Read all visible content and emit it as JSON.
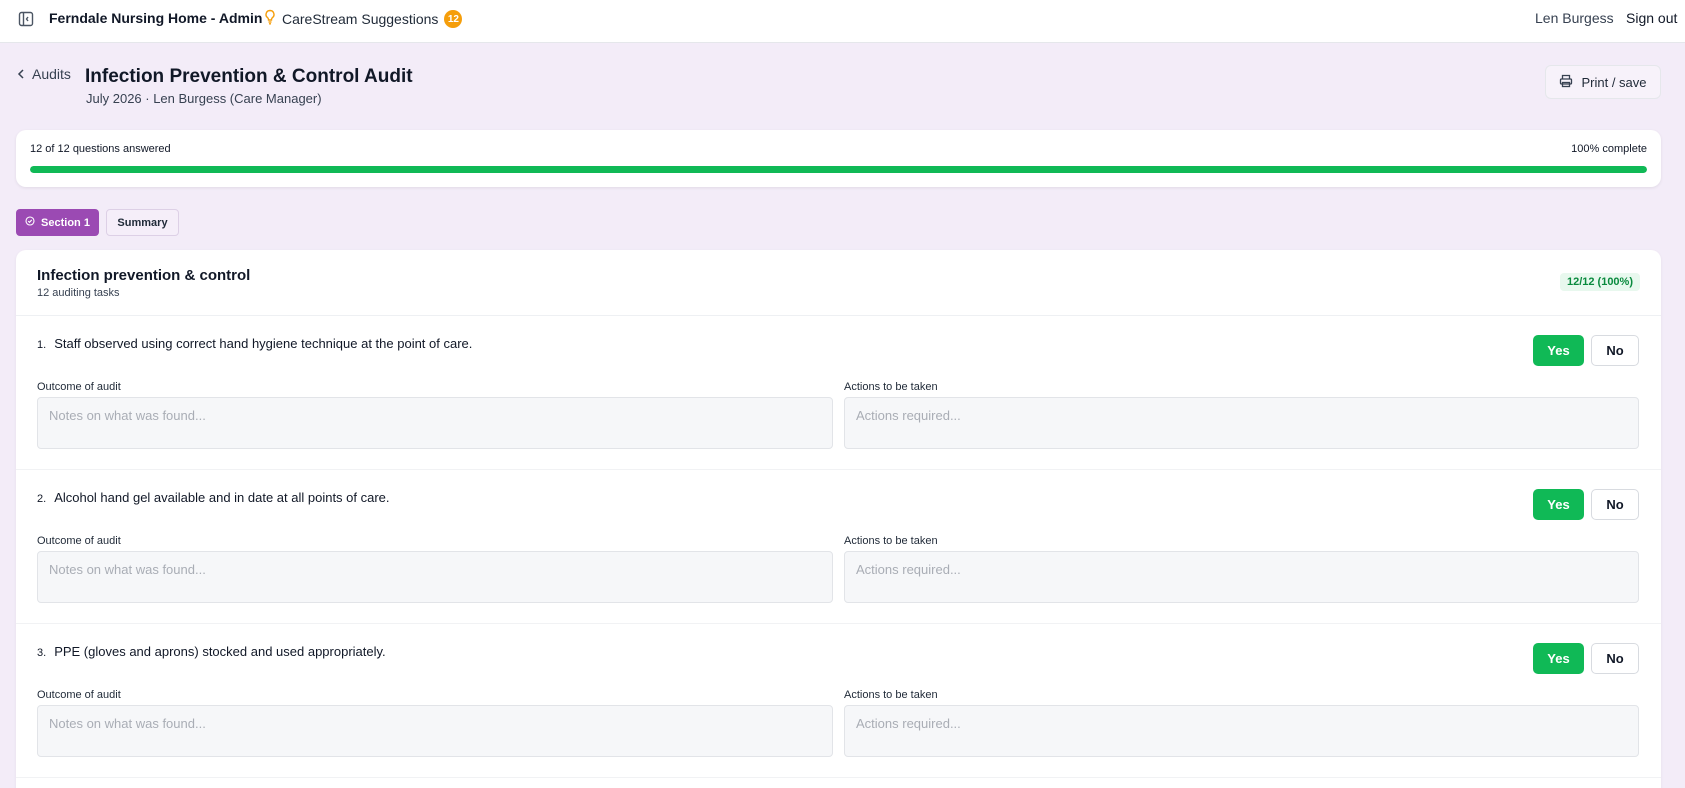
{
  "topbar": {
    "app_title": "Ferndale Nursing Home - Admin",
    "suggestions_label": "CareStream Suggestions",
    "suggestions_count": "12",
    "user_name": "Len Burgess",
    "sign_out_label": "Sign out"
  },
  "header": {
    "back_label": "Audits",
    "title": "Infection Prevention & Control Audit",
    "subtitle": "July 2026 · Len Burgess (Care Manager)",
    "print_label": "Print / save"
  },
  "progress": {
    "answered_text": "12 of 12 questions answered",
    "complete_text": "100% complete",
    "percent": 100
  },
  "tabs": [
    {
      "label": "Section 1",
      "active": true
    },
    {
      "label": "Summary",
      "active": false
    }
  ],
  "section": {
    "title": "Infection prevention & control",
    "subtitle": "12 auditing tasks",
    "badge": "12/12 (100%)",
    "questions": [
      {
        "number": "1.",
        "text": "Staff observed using correct hand hygiene technique at the point of care.",
        "yes_label": "Yes",
        "no_label": "No",
        "outcome_label": "Outcome of audit",
        "outcome_placeholder": "Notes on what was found...",
        "actions_label": "Actions to be taken",
        "actions_placeholder": "Actions required..."
      },
      {
        "number": "2.",
        "text": "Alcohol hand gel available and in date at all points of care.",
        "yes_label": "Yes",
        "no_label": "No",
        "outcome_label": "Outcome of audit",
        "outcome_placeholder": "Notes on what was found...",
        "actions_label": "Actions to be taken",
        "actions_placeholder": "Actions required..."
      },
      {
        "number": "3.",
        "text": "PPE (gloves and aprons) stocked and used appropriately.",
        "yes_label": "Yes",
        "no_label": "No",
        "outcome_label": "Outcome of audit",
        "outcome_placeholder": "Notes on what was found...",
        "actions_label": "Actions to be taken",
        "actions_placeholder": "Actions required..."
      }
    ]
  },
  "colors": {
    "accent": "#9b4ab3",
    "success": "#10b956",
    "badge": "#f59e0b",
    "background": "#f3ecf8"
  },
  "icons": {
    "sidebar_toggle": "panel-left-icon",
    "suggestions": "lightbulb-icon",
    "back": "chevron-left-icon",
    "print": "printer-icon",
    "section_tab": "check-circle-icon"
  }
}
